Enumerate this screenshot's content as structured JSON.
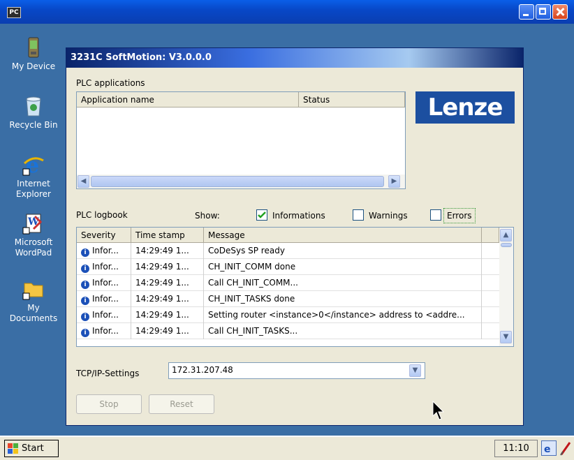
{
  "outer_window": {
    "app_icon_text": "PC"
  },
  "desktop": {
    "icons": [
      {
        "label": "My Device"
      },
      {
        "label": "Recycle Bin"
      },
      {
        "label": "Internet Explorer"
      },
      {
        "label": "Microsoft WordPad"
      },
      {
        "label": "My Documents"
      }
    ]
  },
  "dialog": {
    "title": "3231C SoftMotion: V3.0.0.0",
    "plc_applications": {
      "label": "PLC applications",
      "columns": [
        "Application name",
        "Status"
      ]
    },
    "logo": "Lenze",
    "logbook": {
      "label": "PLC logbook",
      "show_label": "Show:",
      "filters": [
        {
          "label": "Informations",
          "checked": true
        },
        {
          "label": "Warnings",
          "checked": false
        },
        {
          "label": "Errors",
          "checked": false
        }
      ],
      "columns": [
        "Severity",
        "Time stamp",
        "Message"
      ],
      "rows": [
        {
          "severity": "Infor...",
          "time": "14:29:49 1...",
          "message": "CoDeSys SP ready"
        },
        {
          "severity": "Infor...",
          "time": "14:29:49 1...",
          "message": "CH_INIT_COMM done"
        },
        {
          "severity": "Infor...",
          "time": "14:29:49 1...",
          "message": "Call CH_INIT_COMM..."
        },
        {
          "severity": "Infor...",
          "time": "14:29:49 1...",
          "message": "CH_INIT_TASKS done"
        },
        {
          "severity": "Infor...",
          "time": "14:29:49 1...",
          "message": "Setting router <instance>0</instance> address to <addre..."
        },
        {
          "severity": "Infor...",
          "time": "14:29:49 1...",
          "message": "Call CH_INIT_TASKS..."
        }
      ]
    },
    "tcpip": {
      "label": "TCP/IP-Settings",
      "value": "172.31.207.48"
    },
    "buttons": {
      "stop": "Stop",
      "reset": "Reset"
    }
  },
  "taskbar": {
    "start_label": "Start",
    "clock": "11:10"
  },
  "colors": {
    "desktop": "#3a6ea5",
    "title_bar": "#0848c8",
    "dialog_bg": "#ece9d8",
    "logo_bg": "#1c4fa0"
  }
}
